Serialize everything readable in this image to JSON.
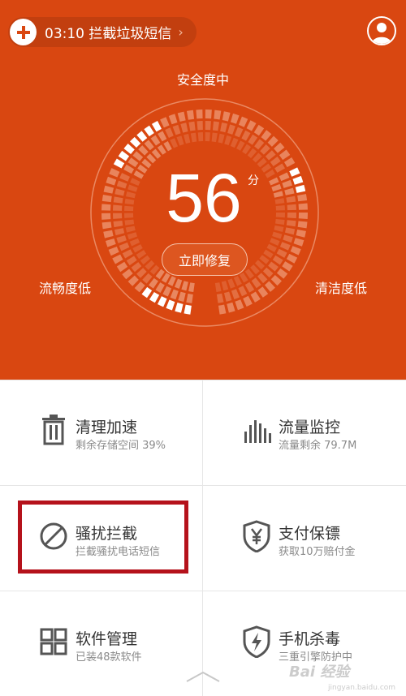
{
  "header": {
    "notification": {
      "text": "03:10 拦截垃圾短信",
      "chevron": "›"
    },
    "avatar": {
      "icon": "user-avatar-icon"
    }
  },
  "gauge": {
    "top_label": "安全度中",
    "left_label": "流畅度低",
    "right_label": "清洁度低",
    "score": "56",
    "unit": "分",
    "fix_button": "立即修复",
    "score_value": 56
  },
  "features": [
    {
      "id": "clean",
      "title": "清理加速",
      "subtitle": "剩余存储空间 39%",
      "icon": "trash-icon"
    },
    {
      "id": "traffic",
      "title": "流量监控",
      "subtitle": "流量剩余 79.7M",
      "icon": "bar-chart-icon"
    },
    {
      "id": "block",
      "title": "骚扰拦截",
      "subtitle": "拦截骚扰电话短信",
      "icon": "block-icon"
    },
    {
      "id": "pay",
      "title": "支付保镖",
      "subtitle": "获取10万赔付金",
      "icon": "yuan-shield-icon"
    },
    {
      "id": "apps",
      "title": "软件管理",
      "subtitle": "已装48款软件",
      "icon": "grid-icon"
    },
    {
      "id": "virus",
      "title": "手机杀毒",
      "subtitle": "三重引擎防护中",
      "icon": "lightning-shield-icon"
    }
  ],
  "watermark": {
    "text": "Bai 经验",
    "sub": "jingyan.baidu.com"
  },
  "colors": {
    "hero": "#d94711",
    "highlight": "#b5121b"
  }
}
